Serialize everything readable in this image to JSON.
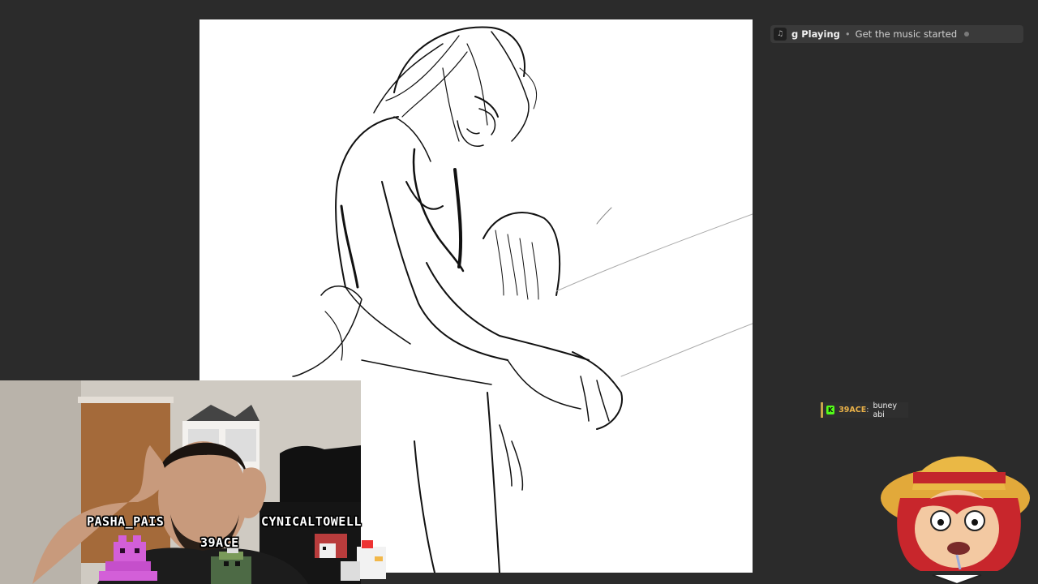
{
  "now_playing": {
    "icon": "music-note-icon",
    "title": "g Playing",
    "separator": "•",
    "subtitle": "Get the music started"
  },
  "chat": {
    "badge_icon": "kick-badge-icon",
    "badge_letter": "K",
    "username": "39ACE",
    "separator": ":",
    "message": "buney abi",
    "username_color": "#e8b048"
  },
  "viewers": {
    "names": [
      "PASHA_PAIS",
      "39ACE",
      "CYNICALTOWELL"
    ]
  },
  "colors": {
    "background": "#2b2b2b",
    "canvas": "#ffffff",
    "accent_gold": "#c9a54a",
    "kick_green": "#53fc18"
  }
}
